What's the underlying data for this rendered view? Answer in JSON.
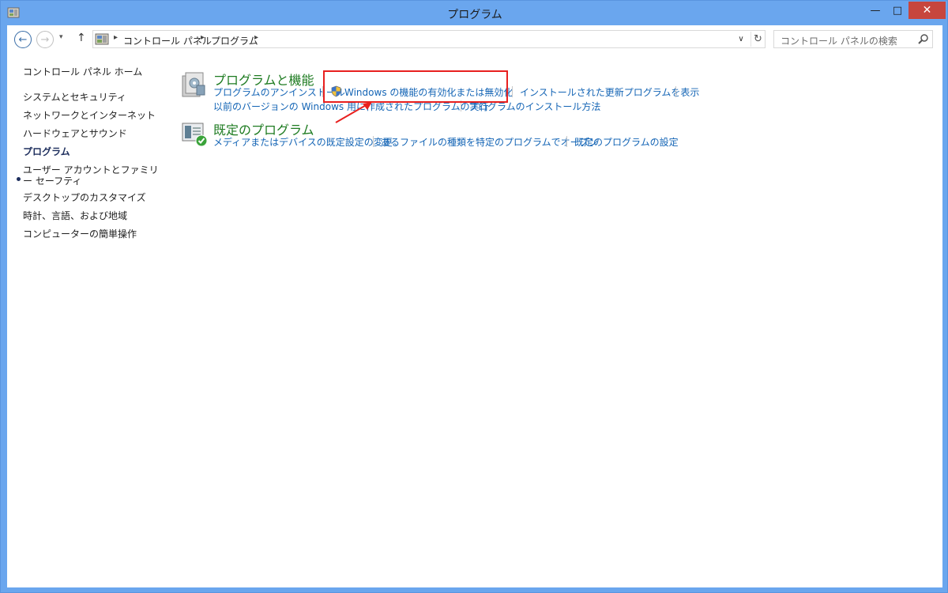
{
  "window": {
    "title": "プログラム",
    "minimize_glyph": "—",
    "maximize_glyph": "□",
    "close_glyph": "✕"
  },
  "nav": {
    "back_glyph": "←",
    "forward_glyph": "→",
    "recent_glyph": "▾",
    "up_glyph": "↑",
    "breadcrumb": [
      "コントロール パネル",
      "プログラム"
    ],
    "breadcrumb_sep": "▸",
    "dropdown_glyph": "∨",
    "refresh_glyph": "↻",
    "search_placeholder": "コントロール パネルの検索"
  },
  "sidebar": {
    "home": "コントロール パネル ホーム",
    "items": [
      "システムとセキュリティ",
      "ネットワークとインターネット",
      "ハードウェアとサウンド",
      "プログラム",
      "ユーザー アカウントとファミリー セーフティ",
      "デスクトップのカスタマイズ",
      "時計、言語、および地域",
      "コンピューターの簡単操作"
    ],
    "active_index": 3
  },
  "categories": {
    "programs_features": {
      "title": "プログラムと機能",
      "links": [
        "プログラムのアンインストール",
        "Windows の機能の有効化または無効化",
        "インストールされた更新プログラムを表示",
        "以前のバージョンの Windows 用に作成されたプログラムの実行",
        "プログラムのインストール方法"
      ]
    },
    "default_programs": {
      "title": "既定のプログラム",
      "links": [
        "メディアまたはデバイスの既定設定の変更",
        "あるファイルの種類を特定のプログラムでオープン",
        "既定のプログラムの設定"
      ]
    }
  },
  "colors": {
    "titlebar": "#6aa6ee",
    "close_button": "#c7463d",
    "link": "#1364b5",
    "category_title": "#1e7b21",
    "annotation": "#e8201f"
  }
}
